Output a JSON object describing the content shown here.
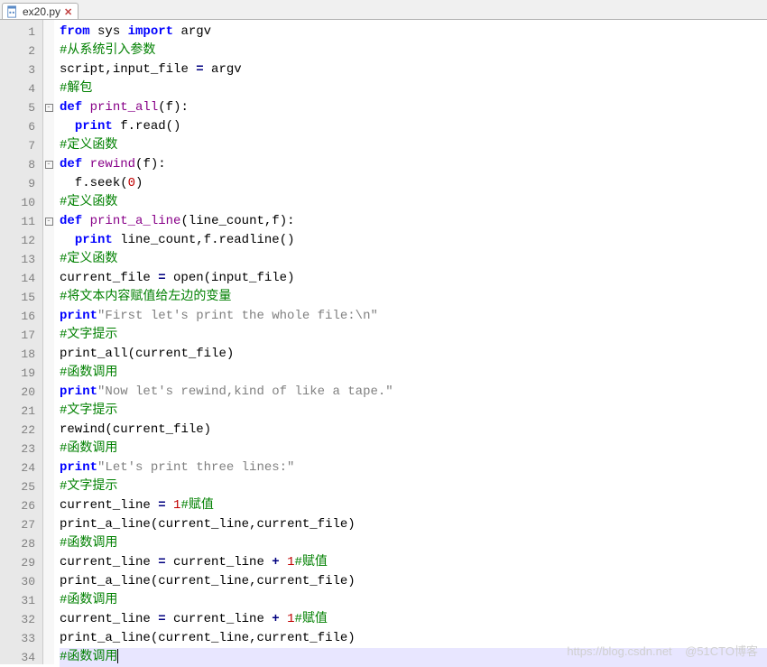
{
  "tab": {
    "filename": "ex20.py"
  },
  "code": {
    "lines": [
      [
        {
          "t": "from",
          "c": "kw"
        },
        {
          "t": " sys "
        },
        {
          "t": "import",
          "c": "kw"
        },
        {
          "t": " argv"
        }
      ],
      [
        {
          "t": "#从系统引入参数",
          "c": "cm"
        }
      ],
      [
        {
          "t": "script"
        },
        {
          "t": ","
        },
        {
          "t": "input_file "
        },
        {
          "t": "=",
          "c": "op"
        },
        {
          "t": " argv"
        }
      ],
      [
        {
          "t": "#解包",
          "c": "cm"
        }
      ],
      [
        {
          "t": "def",
          "c": "kw"
        },
        {
          "t": " "
        },
        {
          "t": "print_all",
          "c": "fn"
        },
        {
          "t": "("
        },
        {
          "t": "f"
        },
        {
          "t": ")"
        },
        {
          "t": ":"
        }
      ],
      [
        {
          "t": "  "
        },
        {
          "t": "print",
          "c": "kw"
        },
        {
          "t": " f"
        },
        {
          "t": "."
        },
        {
          "t": "read"
        },
        {
          "t": "()"
        }
      ],
      [
        {
          "t": "#定义函数",
          "c": "cm"
        }
      ],
      [
        {
          "t": "def",
          "c": "kw"
        },
        {
          "t": " "
        },
        {
          "t": "rewind",
          "c": "fn"
        },
        {
          "t": "("
        },
        {
          "t": "f"
        },
        {
          "t": ")"
        },
        {
          "t": ":"
        }
      ],
      [
        {
          "t": "  f"
        },
        {
          "t": "."
        },
        {
          "t": "seek"
        },
        {
          "t": "("
        },
        {
          "t": "0",
          "c": "num"
        },
        {
          "t": ")"
        }
      ],
      [
        {
          "t": "#定义函数",
          "c": "cm"
        }
      ],
      [
        {
          "t": "def",
          "c": "kw"
        },
        {
          "t": " "
        },
        {
          "t": "print_a_line",
          "c": "fn"
        },
        {
          "t": "("
        },
        {
          "t": "line_count"
        },
        {
          "t": ","
        },
        {
          "t": "f"
        },
        {
          "t": ")"
        },
        {
          "t": ":"
        }
      ],
      [
        {
          "t": "  "
        },
        {
          "t": "print",
          "c": "kw"
        },
        {
          "t": " line_count"
        },
        {
          "t": ","
        },
        {
          "t": "f"
        },
        {
          "t": "."
        },
        {
          "t": "readline"
        },
        {
          "t": "()"
        }
      ],
      [
        {
          "t": "#定义函数",
          "c": "cm"
        }
      ],
      [
        {
          "t": "current_file "
        },
        {
          "t": "=",
          "c": "op"
        },
        {
          "t": " open"
        },
        {
          "t": "("
        },
        {
          "t": "input_file"
        },
        {
          "t": ")"
        }
      ],
      [
        {
          "t": "#将文本内容赋值给左边的变量",
          "c": "cm"
        }
      ],
      [
        {
          "t": "print",
          "c": "kw"
        },
        {
          "t": "\"First let's print the whole file:\\n\"",
          "c": "str"
        }
      ],
      [
        {
          "t": "#文字提示",
          "c": "cm"
        }
      ],
      [
        {
          "t": "print_all"
        },
        {
          "t": "("
        },
        {
          "t": "current_file"
        },
        {
          "t": ")"
        }
      ],
      [
        {
          "t": "#函数调用",
          "c": "cm"
        }
      ],
      [
        {
          "t": "print",
          "c": "kw"
        },
        {
          "t": "\"Now let's rewind,kind of like a tape.\"",
          "c": "str"
        }
      ],
      [
        {
          "t": "#文字提示",
          "c": "cm"
        }
      ],
      [
        {
          "t": "rewind"
        },
        {
          "t": "("
        },
        {
          "t": "current_file"
        },
        {
          "t": ")"
        }
      ],
      [
        {
          "t": "#函数调用",
          "c": "cm"
        }
      ],
      [
        {
          "t": "print",
          "c": "kw"
        },
        {
          "t": "\"Let's print three lines:\"",
          "c": "str"
        }
      ],
      [
        {
          "t": "#文字提示",
          "c": "cm"
        }
      ],
      [
        {
          "t": "current_line "
        },
        {
          "t": "=",
          "c": "op"
        },
        {
          "t": " "
        },
        {
          "t": "1",
          "c": "num"
        },
        {
          "t": "#赋值",
          "c": "cm"
        }
      ],
      [
        {
          "t": "print_a_line"
        },
        {
          "t": "("
        },
        {
          "t": "current_line"
        },
        {
          "t": ","
        },
        {
          "t": "current_file"
        },
        {
          "t": ")"
        }
      ],
      [
        {
          "t": "#函数调用",
          "c": "cm"
        }
      ],
      [
        {
          "t": "current_line "
        },
        {
          "t": "=",
          "c": "op"
        },
        {
          "t": " current_line "
        },
        {
          "t": "+",
          "c": "op"
        },
        {
          "t": " "
        },
        {
          "t": "1",
          "c": "num"
        },
        {
          "t": "#赋值",
          "c": "cm"
        }
      ],
      [
        {
          "t": "print_a_line"
        },
        {
          "t": "("
        },
        {
          "t": "current_line"
        },
        {
          "t": ","
        },
        {
          "t": "current_file"
        },
        {
          "t": ")"
        }
      ],
      [
        {
          "t": "#函数调用",
          "c": "cm"
        }
      ],
      [
        {
          "t": "current_line "
        },
        {
          "t": "=",
          "c": "op"
        },
        {
          "t": " current_line "
        },
        {
          "t": "+",
          "c": "op"
        },
        {
          "t": " "
        },
        {
          "t": "1",
          "c": "num"
        },
        {
          "t": "#赋值",
          "c": "cm"
        }
      ],
      [
        {
          "t": "print_a_line"
        },
        {
          "t": "("
        },
        {
          "t": "current_line"
        },
        {
          "t": ","
        },
        {
          "t": "current_file"
        },
        {
          "t": ")"
        }
      ],
      [
        {
          "t": "#函数调用",
          "c": "cm"
        }
      ]
    ],
    "foldLines": [
      5,
      8,
      11
    ],
    "highlightedLine": 34,
    "caretLine": 34
  },
  "watermark": {
    "left": "https://blog.csdn.net",
    "right": "@51CTO博客"
  }
}
